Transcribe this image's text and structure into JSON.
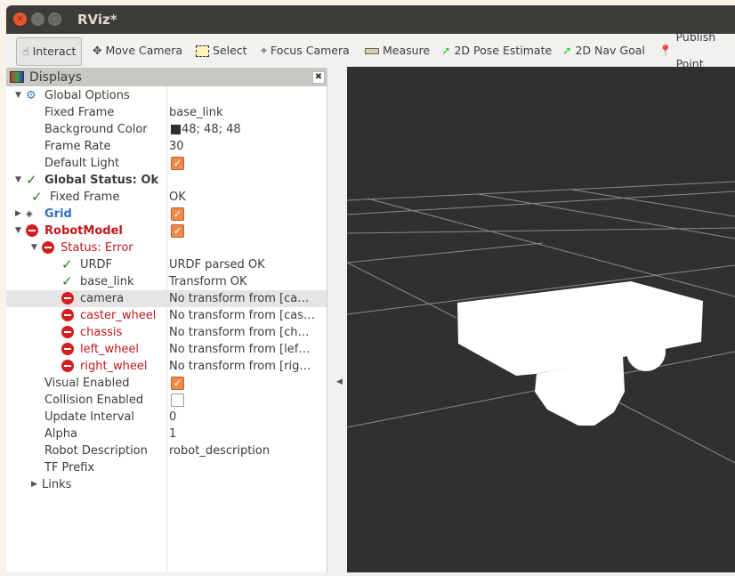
{
  "window": {
    "title": "RViz*"
  },
  "toolbar": [
    {
      "label": "Interact",
      "icon": "hand-icon"
    },
    {
      "label": "Move Camera",
      "icon": "move-camera-icon"
    },
    {
      "label": "Select",
      "icon": "select-icon"
    },
    {
      "label": "Focus Camera",
      "icon": "focus-camera-icon"
    },
    {
      "label": "Measure",
      "icon": "ruler-icon"
    },
    {
      "label": "2D Pose Estimate",
      "icon": "green-arrow-icon"
    },
    {
      "label": "2D Nav Goal",
      "icon": "green-arrow-icon"
    },
    {
      "label": "Publish Point",
      "icon": "map-pin-icon"
    }
  ],
  "displays": {
    "title": "Displays",
    "rows": [
      {
        "name": "Global Options",
        "value": ""
      },
      {
        "name": "Fixed Frame",
        "value": "base_link"
      },
      {
        "name": "Background Color",
        "value": "48; 48; 48"
      },
      {
        "name": "Frame Rate",
        "value": "30"
      },
      {
        "name": "Default Light",
        "value": ""
      },
      {
        "name": "Global Status: Ok",
        "value": ""
      },
      {
        "name": "Fixed Frame",
        "value": "OK"
      },
      {
        "name": "Grid",
        "value": ""
      },
      {
        "name": "RobotModel",
        "value": ""
      },
      {
        "name": "Status: Error",
        "value": ""
      },
      {
        "name": "URDF",
        "value": "URDF parsed OK"
      },
      {
        "name": "base_link",
        "value": "Transform OK"
      },
      {
        "name": "camera",
        "value": "No transform from [ca…"
      },
      {
        "name": "caster_wheel",
        "value": "No transform from [cas…"
      },
      {
        "name": "chassis",
        "value": "No transform from [ch…"
      },
      {
        "name": "left_wheel",
        "value": "No transform from [lef…"
      },
      {
        "name": "right_wheel",
        "value": "No transform from [rig…"
      },
      {
        "name": "Visual Enabled",
        "value": ""
      },
      {
        "name": "Collision Enabled",
        "value": ""
      },
      {
        "name": "Update Interval",
        "value": "0"
      },
      {
        "name": "Alpha",
        "value": "1"
      },
      {
        "name": "Robot Description",
        "value": "robot_description"
      },
      {
        "name": "TF Prefix",
        "value": ""
      },
      {
        "name": "Links",
        "value": ""
      }
    ]
  },
  "colors": {
    "background": "#303030",
    "error": "#c3181c",
    "ok": "#2b7a1e",
    "accent": "#f08a4b"
  }
}
